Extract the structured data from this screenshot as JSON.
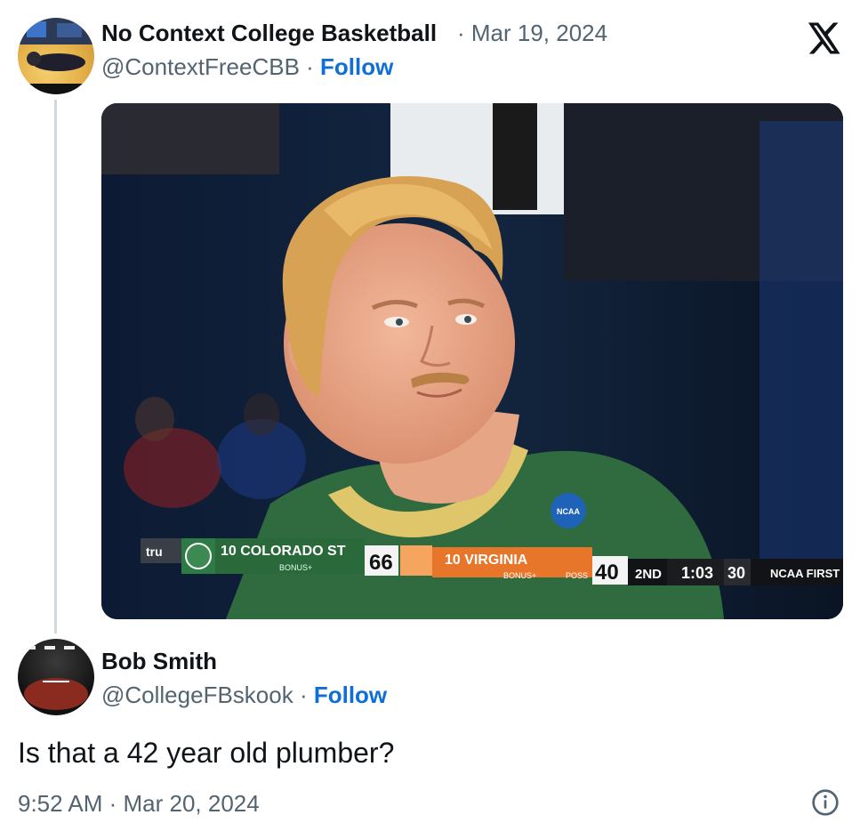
{
  "tweet1": {
    "display_name": "No Context College Basketball",
    "separator_date": "· Mar 19, 2024",
    "handle": "@ContextFreeCBB",
    "separator": " · ",
    "follow_label": "Follow"
  },
  "media": {
    "scorebug": {
      "network": "tru",
      "team1": "10 COLORADO ST",
      "team1_sub": "BONUS+",
      "score1": "66",
      "team2": "10 VIRGINIA",
      "team2_sub": "BONUS+",
      "team2_poss": "POSS",
      "score2": "40",
      "period": "2ND",
      "clock": "1:03",
      "shot_clock": "30",
      "ticker": "NCAA FIRST",
      "jersey_patch": "NCAA"
    }
  },
  "tweet2": {
    "display_name": "Bob Smith",
    "handle": "@CollegeFBskook",
    "separator": " · ",
    "follow_label": "Follow",
    "text": "Is that a 42 year old plumber?",
    "timestamp": "9:52 AM · Mar 20, 2024"
  },
  "colors": {
    "follow": "#0f6fd6",
    "secondary_text": "#536471",
    "thread_line": "#cfd9de",
    "colorado_green": "#2a6a3a",
    "virginia_orange": "#e7762a"
  }
}
